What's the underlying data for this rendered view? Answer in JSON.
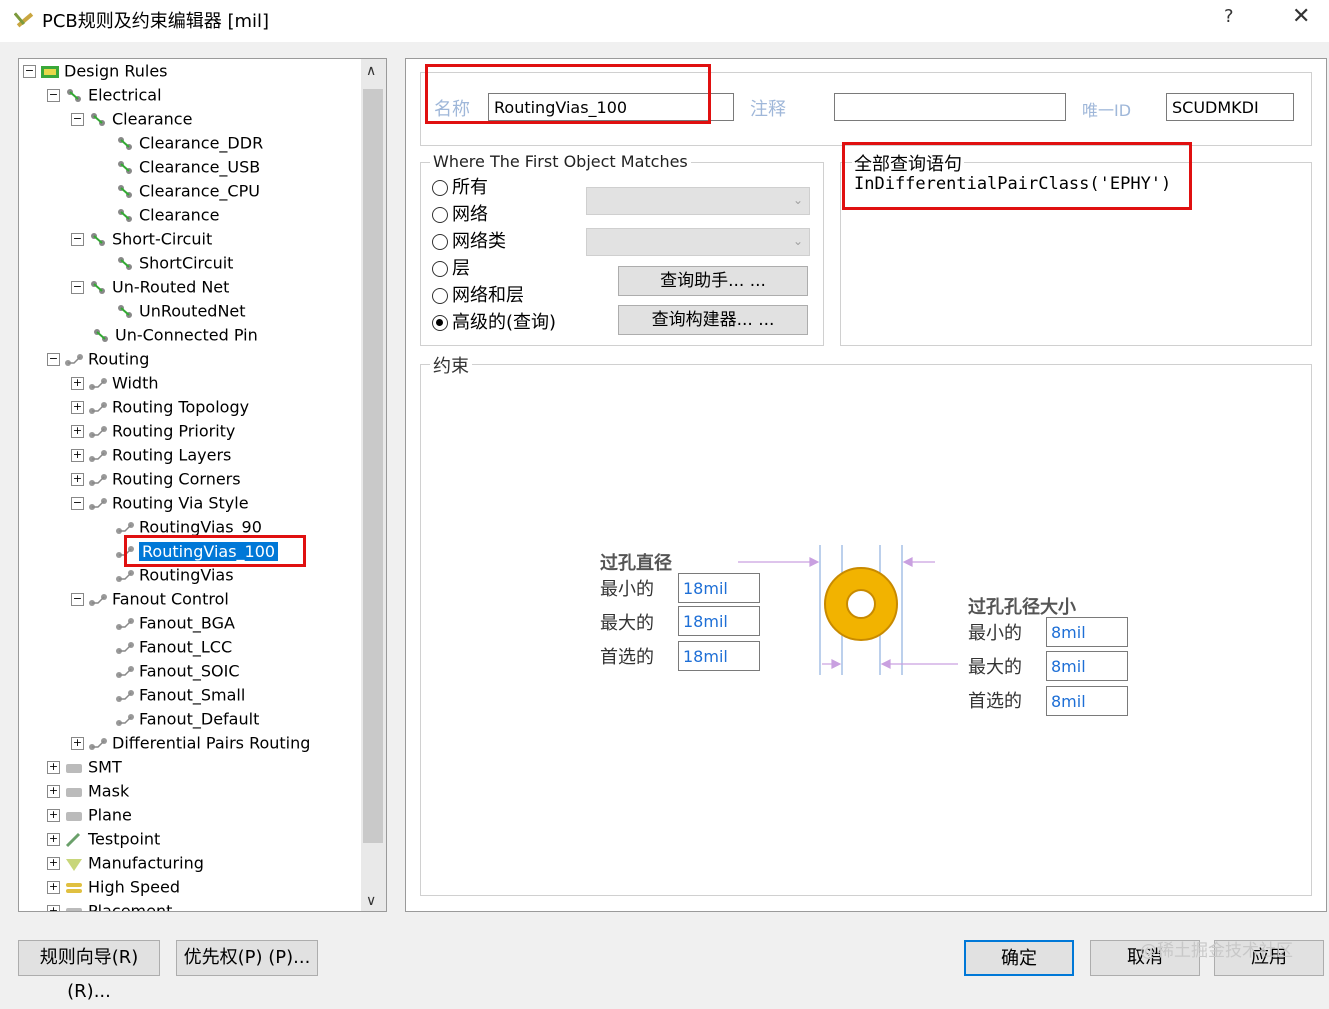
{
  "window": {
    "title": "PCB规则及约束编辑器 [mil]",
    "help_label": "?",
    "close_label": "✕"
  },
  "tree": {
    "items": [
      {
        "label": "Design Rules",
        "level": 0,
        "expander": "−",
        "icon": "design-rules-icon"
      },
      {
        "label": "Electrical",
        "level": 1,
        "expander": "−",
        "icon": "electrical-rule-icon"
      },
      {
        "label": "Clearance",
        "level": 2,
        "expander": "−",
        "icon": "electrical-rule-icon"
      },
      {
        "label": "Clearance_DDR",
        "level": 3,
        "expander": "",
        "icon": "electrical-rule-icon"
      },
      {
        "label": "Clearance_USB",
        "level": 3,
        "expander": "",
        "icon": "electrical-rule-icon"
      },
      {
        "label": "Clearance_CPU",
        "level": 3,
        "expander": "",
        "icon": "electrical-rule-icon"
      },
      {
        "label": "Clearance",
        "level": 3,
        "expander": "",
        "icon": "electrical-rule-icon"
      },
      {
        "label": "Short-Circuit",
        "level": 2,
        "expander": "−",
        "icon": "electrical-rule-icon"
      },
      {
        "label": "ShortCircuit",
        "level": 3,
        "expander": "",
        "icon": "electrical-rule-icon"
      },
      {
        "label": "Un-Routed Net",
        "level": 2,
        "expander": "−",
        "icon": "electrical-rule-icon"
      },
      {
        "label": "UnRoutedNet",
        "level": 3,
        "expander": "",
        "icon": "electrical-rule-icon"
      },
      {
        "label": "Un-Connected Pin",
        "level": 2,
        "expander": "",
        "icon": "electrical-rule-icon"
      },
      {
        "label": "Routing",
        "level": 1,
        "expander": "−",
        "icon": "routing-rule-icon"
      },
      {
        "label": "Width",
        "level": 2,
        "expander": "+",
        "icon": "routing-rule-icon"
      },
      {
        "label": "Routing Topology",
        "level": 2,
        "expander": "+",
        "icon": "routing-rule-icon"
      },
      {
        "label": "Routing Priority",
        "level": 2,
        "expander": "+",
        "icon": "routing-rule-icon"
      },
      {
        "label": "Routing Layers",
        "level": 2,
        "expander": "+",
        "icon": "routing-rule-icon"
      },
      {
        "label": "Routing Corners",
        "level": 2,
        "expander": "+",
        "icon": "routing-rule-icon"
      },
      {
        "label": "Routing Via Style",
        "level": 2,
        "expander": "−",
        "icon": "routing-rule-icon"
      },
      {
        "label": "RoutingVias_90",
        "level": 3,
        "expander": "",
        "icon": "routing-rule-icon"
      },
      {
        "label": "RoutingVias_100",
        "level": 3,
        "expander": "",
        "icon": "routing-rule-icon",
        "selected": true
      },
      {
        "label": "RoutingVias",
        "level": 3,
        "expander": "",
        "icon": "routing-rule-icon"
      },
      {
        "label": "Fanout Control",
        "level": 2,
        "expander": "−",
        "icon": "routing-rule-icon"
      },
      {
        "label": "Fanout_BGA",
        "level": 3,
        "expander": "",
        "icon": "routing-rule-icon"
      },
      {
        "label": "Fanout_LCC",
        "level": 3,
        "expander": "",
        "icon": "routing-rule-icon"
      },
      {
        "label": "Fanout_SOIC",
        "level": 3,
        "expander": "",
        "icon": "routing-rule-icon"
      },
      {
        "label": "Fanout_Small",
        "level": 3,
        "expander": "",
        "icon": "routing-rule-icon"
      },
      {
        "label": "Fanout_Default",
        "level": 3,
        "expander": "",
        "icon": "routing-rule-icon"
      },
      {
        "label": "Differential Pairs Routing",
        "level": 2,
        "expander": "+",
        "icon": "routing-rule-icon"
      },
      {
        "label": "SMT",
        "level": 1,
        "expander": "+",
        "icon": "smt-icon"
      },
      {
        "label": "Mask",
        "level": 1,
        "expander": "+",
        "icon": "mask-icon"
      },
      {
        "label": "Plane",
        "level": 1,
        "expander": "+",
        "icon": "plane-icon"
      },
      {
        "label": "Testpoint",
        "level": 1,
        "expander": "+",
        "icon": "testpoint-icon"
      },
      {
        "label": "Manufacturing",
        "level": 1,
        "expander": "+",
        "icon": "manufacturing-icon"
      },
      {
        "label": "High Speed",
        "level": 1,
        "expander": "+",
        "icon": "high-speed-icon"
      },
      {
        "label": "Placement",
        "level": 1,
        "expander": "+",
        "icon": "placement-icon"
      }
    ]
  },
  "rule": {
    "name_label": "名称",
    "name_value": "RoutingVias_100",
    "comment_label": "注释",
    "comment_value": "",
    "uid_label": "唯一ID",
    "uid_value": "SCUDMKDI"
  },
  "match": {
    "group_label": "Where The First Object Matches",
    "options": [
      "所有",
      "网络",
      "网络类",
      "层",
      "网络和层",
      "高级的(查询)"
    ],
    "selected_index": 5,
    "query_helper_label": "查询助手... ...",
    "query_builder_label": "查询构建器... ..."
  },
  "query": {
    "group_label": "全部查询语句",
    "text": "InDifferentialPairClass('EPHY')"
  },
  "constraints": {
    "group_label": "约束",
    "via_diameter_label": "过孔直径",
    "via_hole_label": "过孔孔径大小",
    "min_label": "最小的",
    "max_label": "最大的",
    "pref_label": "首选的",
    "diameter_min": "18mil",
    "diameter_max": "18mil",
    "diameter_pref": "18mil",
    "hole_min": "8mil",
    "hole_max": "8mil",
    "hole_pref": "8mil"
  },
  "footer": {
    "rule_wizard_label": "规则向导(R) (R)...",
    "priority_label": "优先权(P) (P)...",
    "ok_label": "确定",
    "cancel_label": "取消",
    "apply_label": "应用",
    "watermark": "@稀土掘金技术社区"
  },
  "colors": {
    "selection": "#0078d7",
    "highlight_box": "#e01010",
    "via_ring": "#f2b300",
    "dim_label": "#9fb7d9",
    "arrow": "#c9a0e0"
  }
}
